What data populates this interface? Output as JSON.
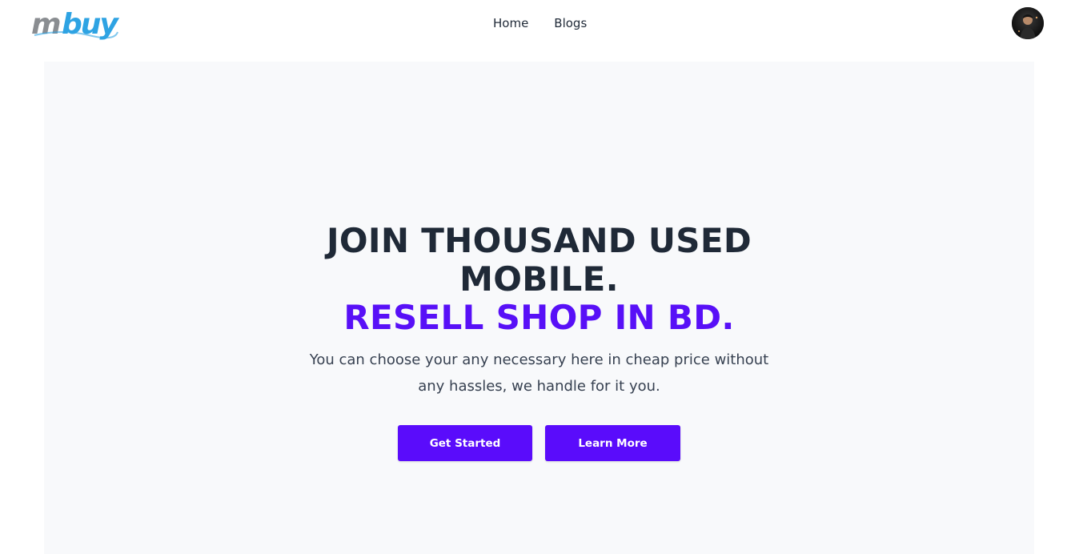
{
  "brand": {
    "logo_text": "mbuy",
    "colors": {
      "logo_gray": "#8a8d91",
      "logo_blue": "#2ea3e3",
      "accent": "#5810f7",
      "button": "#5a0cfb",
      "hero_bg": "#f8f9fb",
      "heading": "#1f2937"
    }
  },
  "nav": {
    "items": [
      {
        "label": "Home"
      },
      {
        "label": "Blogs"
      }
    ]
  },
  "user": {
    "avatar_icon": "user-avatar"
  },
  "hero": {
    "headline_line1": "JOIN THOUSAND USED",
    "headline_line2": "MOBILE.",
    "headline_accent": "RESELL SHOP IN BD.",
    "subtext": "You can choose your any necessary here in cheap price without any hassles, we handle for it you.",
    "buttons": {
      "primary_label": "Get Started",
      "secondary_label": "Learn More"
    }
  }
}
